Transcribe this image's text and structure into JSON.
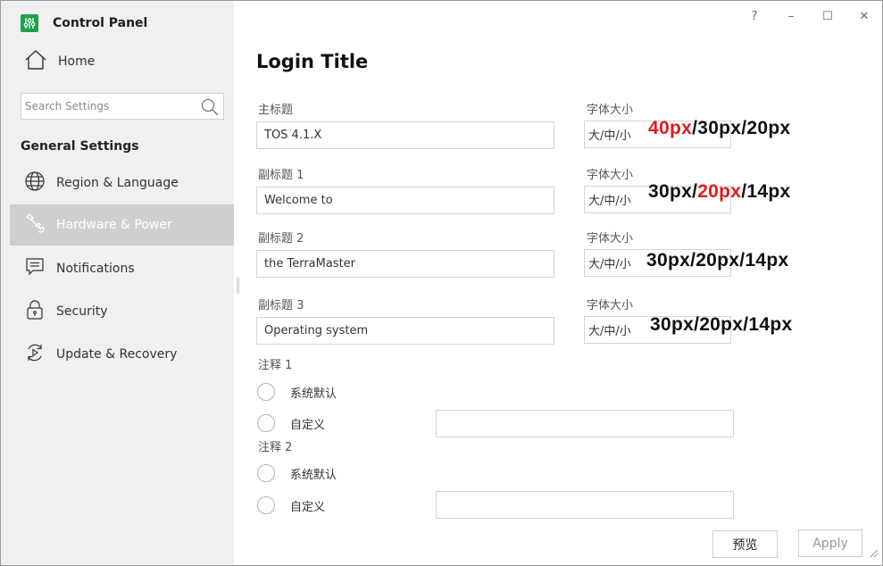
{
  "app": {
    "title": "Control Panel",
    "accent": "#1aa34a"
  },
  "window_controls": {
    "help": "?",
    "minimize": "–",
    "maximize": "☐",
    "close": "✕"
  },
  "sidebar": {
    "home_label": "Home",
    "search_placeholder": "Search Settings",
    "section_title": "General Settings",
    "items": [
      {
        "label": "Region & Language",
        "icon": "globe-icon"
      },
      {
        "label": "Hardware & Power",
        "icon": "wrench-icon",
        "active": true
      },
      {
        "label": "Notifications",
        "icon": "message-icon"
      },
      {
        "label": "Security",
        "icon": "lock-icon"
      },
      {
        "label": "Update & Recovery",
        "icon": "refresh-icon"
      }
    ]
  },
  "main": {
    "title": "Login Title",
    "font_size_label": "字体大小",
    "rows": [
      {
        "label": "主标题",
        "value": "TOS 4.1.X",
        "size_value": "大/中/小",
        "annotation": [
          "40px",
          "/30px/20px"
        ]
      },
      {
        "label": "副标题 1",
        "value": "Welcome to",
        "size_value": "大/中/小",
        "annotation": [
          "30px/",
          "20px",
          "/14px"
        ]
      },
      {
        "label": "副标题 2",
        "value": "the TerraMaster",
        "size_value": "大/中/小",
        "annotation": "30px/20px/14px"
      },
      {
        "label": "副标题 3",
        "value": "Operating system",
        "size_value": "大/中/小",
        "annotation": "30px/20px/14px"
      }
    ],
    "notes": [
      {
        "label": "注释 1",
        "option_default": "系统默认",
        "option_custom": "自定义"
      },
      {
        "label": "注释 2",
        "option_default": "系统默认",
        "option_custom": "自定义"
      }
    ],
    "buttons": {
      "preview": "预览",
      "apply": "Apply"
    }
  }
}
